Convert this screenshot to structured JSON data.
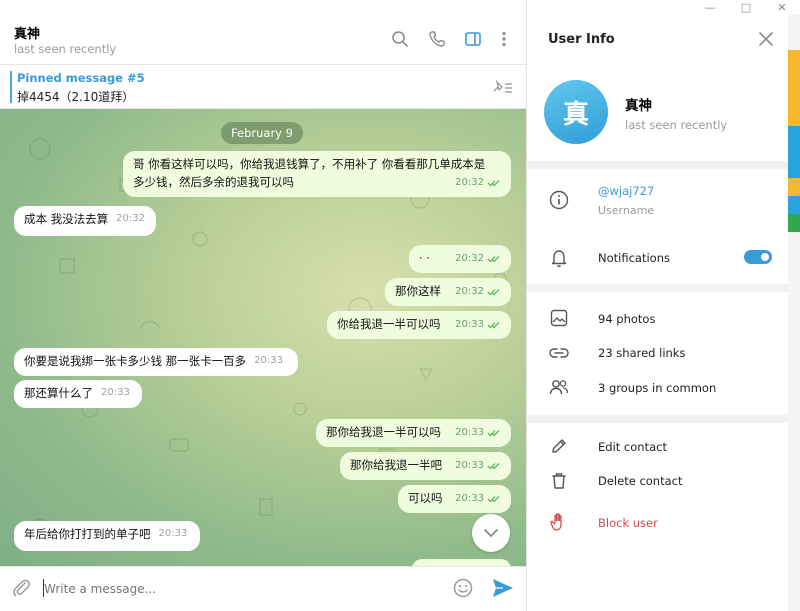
{
  "window": {
    "minimize": "—",
    "maximize": "□",
    "close": "✕"
  },
  "chat": {
    "title": "真神",
    "status": "last seen recently",
    "pinned": {
      "title": "Pinned message #5",
      "text": "掉4454（2.10道拜）"
    },
    "date_pill": "February 9",
    "messages": [
      {
        "dir": "out",
        "lines": [
          "哥 你看这样可以吗，你给我退钱算了，不用补了 你看看那几单成本是",
          "多少钱，然后多余的退我可以吗"
        ],
        "time": "20:32",
        "read": true
      },
      {
        "dir": "in",
        "lines": [
          "成本 我没法去算"
        ],
        "time": "20:32"
      },
      {
        "dir": "out",
        "lines": [
          "· ·"
        ],
        "time": "20:32",
        "read": true
      },
      {
        "dir": "out",
        "lines": [
          "那你这样"
        ],
        "time": "20:32",
        "read": true
      },
      {
        "dir": "out",
        "lines": [
          "你给我退一半可以吗"
        ],
        "time": "20:33",
        "read": true
      },
      {
        "dir": "in",
        "lines": [
          "你要是说我绑一张卡多少钱 那一张卡一百多"
        ],
        "time": "20:33"
      },
      {
        "dir": "in",
        "lines": [
          "那还算什么了"
        ],
        "time": "20:33"
      },
      {
        "dir": "out",
        "lines": [
          "那你给我退一半可以吗"
        ],
        "time": "20:33",
        "read": true
      },
      {
        "dir": "out",
        "lines": [
          "那你给我退一半吧"
        ],
        "time": "20:33",
        "read": true
      },
      {
        "dir": "out",
        "lines": [
          "可以吗"
        ],
        "time": "20:33",
        "read": true
      },
      {
        "dir": "in",
        "lines": [
          "年后给你打打到的单子吧"
        ],
        "time": "20:33"
      }
    ],
    "composer_placeholder": "Write a message..."
  },
  "info": {
    "title": "User Info",
    "avatar_letter": "真",
    "name": "真神",
    "status": "last seen recently",
    "username": "@wjaj727",
    "username_label": "Username",
    "notifications_label": "Notifications",
    "notifications_on": true,
    "photos": "94 photos",
    "links": "23 shared links",
    "groups": "3 groups in common",
    "edit_contact": "Edit contact",
    "delete_contact": "Delete contact",
    "block_user": "Block user"
  },
  "colors": {
    "accent": "#3a9ad9",
    "outgoing_bubble": "#effdde",
    "danger": "#d84a4a"
  }
}
